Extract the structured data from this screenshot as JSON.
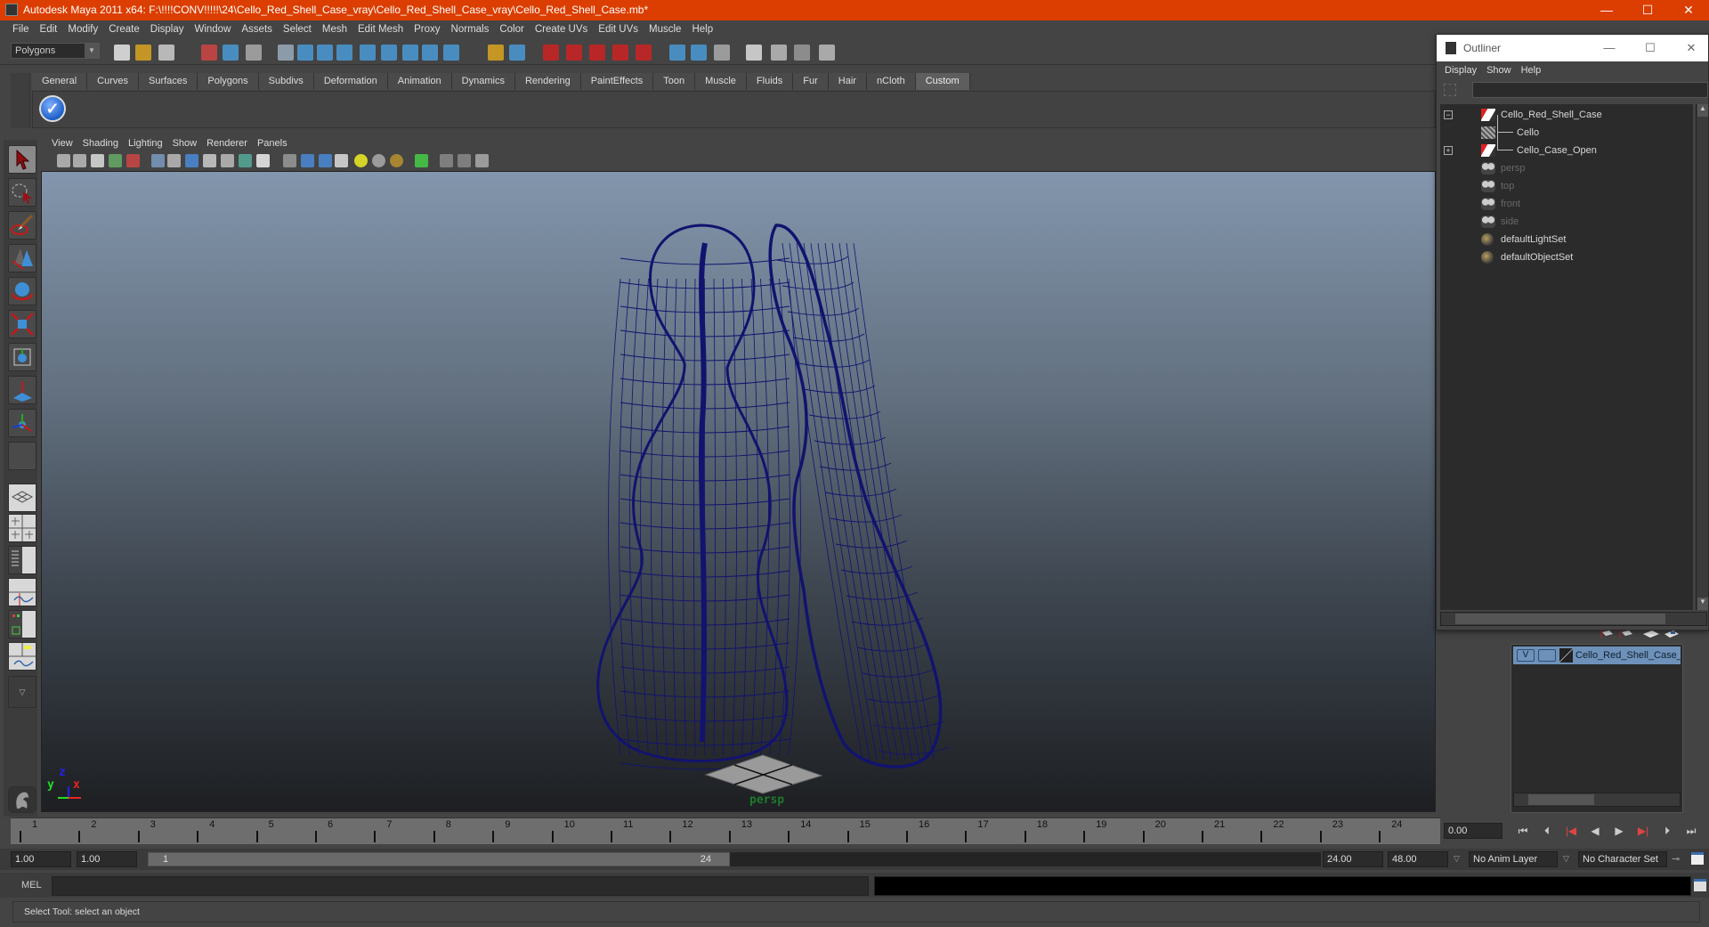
{
  "window": {
    "title": "Autodesk Maya 2011 x64: F:\\!!!!CONV!!!!!\\24\\Cello_Red_Shell_Case_vray\\Cello_Red_Shell_Case_vray\\Cello_Red_Shell_Case.mb*",
    "controls": {
      "minimize": "—",
      "maximize": "☐",
      "close": "✕"
    }
  },
  "menubar": [
    "File",
    "Edit",
    "Modify",
    "Create",
    "Display",
    "Window",
    "Assets",
    "Select",
    "Mesh",
    "Edit Mesh",
    "Proxy",
    "Normals",
    "Color",
    "Create UVs",
    "Edit UVs",
    "Muscle",
    "Help"
  ],
  "statusline": {
    "mode": "Polygons",
    "icons": [
      "new-scene",
      "open-scene",
      "save-scene",
      "select-by-hierarchy",
      "select-by-object",
      "select-by-component",
      "mask-all",
      "select-handles",
      "select-joints",
      "select-curves",
      "select-surfaces",
      "select-deformations",
      "select-dynamics",
      "select-rendering",
      "select-misc",
      "lock-selection",
      "highlight-selection",
      "snap-to-grid",
      "snap-to-curve",
      "snap-to-point",
      "snap-to-view-plane",
      "make-live",
      "input-ops",
      "output-ops",
      "construction-history",
      "render-view",
      "render-frame",
      "ipr-render",
      "render-settings"
    ]
  },
  "shelf": {
    "tabs": [
      "General",
      "Curves",
      "Surfaces",
      "Polygons",
      "Subdivs",
      "Deformation",
      "Animation",
      "Dynamics",
      "Rendering",
      "PaintEffects",
      "Toon",
      "Muscle",
      "Fluids",
      "Fur",
      "Hair",
      "nCloth",
      "Custom"
    ],
    "active_tab": "Custom",
    "items": [
      "checkmark-script"
    ]
  },
  "toolbox": {
    "tools": [
      "select-tool",
      "lasso-tool",
      "paint-select-tool",
      "move-tool",
      "rotate-tool",
      "scale-tool",
      "universal-manipulator",
      "soft-modification-tool",
      "show-manipulator",
      "last-tool-used"
    ],
    "active": "select-tool",
    "layouts": [
      "single-perspective",
      "four-view",
      "persp-outliner",
      "persp-graph",
      "hypershade-persp",
      "persp-graph-hypergraph"
    ]
  },
  "panel": {
    "menus": [
      "View",
      "Shading",
      "Lighting",
      "Show",
      "Renderer",
      "Panels"
    ],
    "camera_label": "persp",
    "axis": {
      "x": "x",
      "y": "y",
      "z": "z"
    },
    "wire_color": "#12136e"
  },
  "timeline": {
    "frames": [
      1,
      2,
      3,
      4,
      5,
      6,
      7,
      8,
      9,
      10,
      11,
      12,
      13,
      14,
      15,
      16,
      17,
      18,
      19,
      20,
      21,
      22,
      23,
      24
    ],
    "current_time": "0.00",
    "playback": [
      "go-to-start",
      "step-back-frame",
      "step-back-key",
      "play-backwards",
      "play-forwards",
      "step-forward-key",
      "step-forward-frame",
      "go-to-end"
    ]
  },
  "range": {
    "start_time": "1.00",
    "playback_start": "1.00",
    "range_start_label": "1",
    "range_end_label": "24",
    "playback_end": "24.00",
    "end_time": "48.00",
    "anim_layer": "No Anim Layer",
    "character_set": "No Character Set"
  },
  "command_line": {
    "label": "MEL",
    "value": ""
  },
  "help_line": "Select Tool: select an object",
  "outliner": {
    "title": "Outliner",
    "menus": [
      "Display",
      "Show",
      "Help"
    ],
    "filter_value": "",
    "items": [
      {
        "name": "Cello_Red_Shell_Case",
        "icon": "transform-icon",
        "expander": "−",
        "dimmed": false,
        "depth": 0
      },
      {
        "name": "Cello",
        "icon": "mesh-icon",
        "expander": "",
        "dimmed": false,
        "depth": 1
      },
      {
        "name": "Cello_Case_Open",
        "icon": "transform-icon",
        "expander": "+",
        "dimmed": false,
        "depth": 1
      },
      {
        "name": "persp",
        "icon": "camera-icon",
        "expander": "",
        "dimmed": true,
        "depth": 0
      },
      {
        "name": "top",
        "icon": "camera-icon",
        "expander": "",
        "dimmed": true,
        "depth": 0
      },
      {
        "name": "front",
        "icon": "camera-icon",
        "expander": "",
        "dimmed": true,
        "depth": 0
      },
      {
        "name": "side",
        "icon": "camera-icon",
        "expander": "",
        "dimmed": true,
        "depth": 0
      },
      {
        "name": "defaultLightSet",
        "icon": "set-icon",
        "expander": "",
        "dimmed": false,
        "depth": 0
      },
      {
        "name": "defaultObjectSet",
        "icon": "set-icon",
        "expander": "",
        "dimmed": false,
        "depth": 0
      }
    ]
  },
  "layer_editor": {
    "layers": [
      {
        "visible": "V",
        "template": "",
        "name": "Cello_Red_Shell_Case_layer"
      }
    ]
  },
  "colors": {
    "titlebar": "#db3e00",
    "layer_selected": "#6e91b9",
    "persp_label": "#1e7a2c"
  }
}
